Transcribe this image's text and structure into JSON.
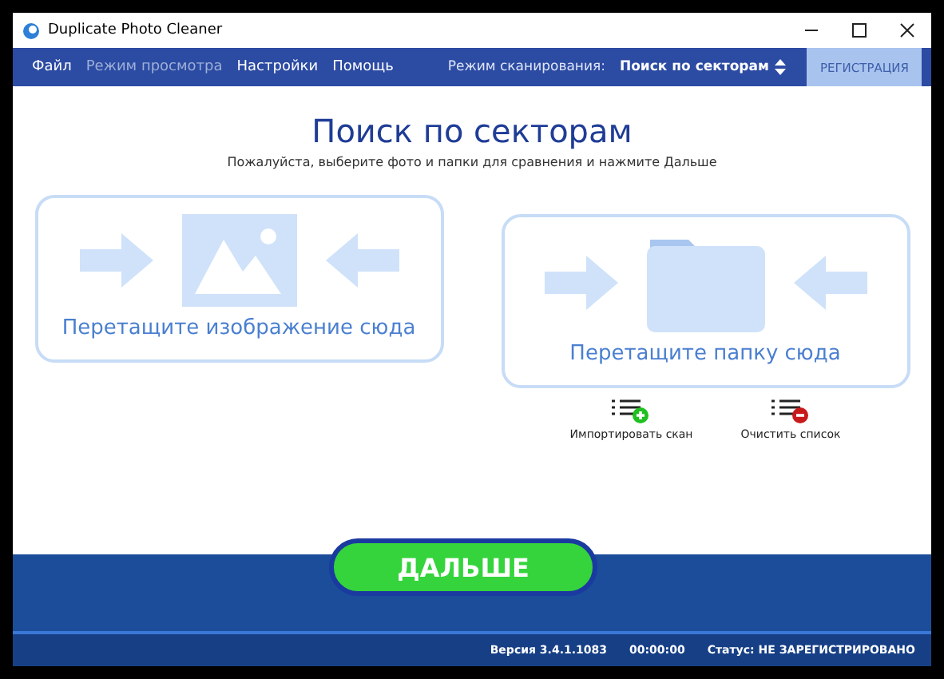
{
  "window": {
    "title": "Duplicate Photo Cleaner"
  },
  "menu": [
    {
      "label": "Файл",
      "disabled": false
    },
    {
      "label": "Режим просмотра",
      "disabled": true
    },
    {
      "label": "Настройки",
      "disabled": false
    },
    {
      "label": "Помощь",
      "disabled": false
    }
  ],
  "scan_mode": {
    "label": "Режим сканирования:",
    "value": "Поиск по секторам"
  },
  "register_button": "РЕГИСТРАЦИЯ",
  "heading": "Поиск по секторам",
  "subtitle": "Пожалуйста, выберите фото и папки для сравнения и нажмите Дальше",
  "drop_zones": [
    {
      "kind": "image",
      "label": "Перетащите изображение сюда"
    },
    {
      "kind": "folder",
      "label": "Перетащите папку сюда"
    }
  ],
  "actions": [
    {
      "kind": "add",
      "label": "Импортировать скан"
    },
    {
      "kind": "remove",
      "label": "Очистить список"
    }
  ],
  "next_button": "ДАЛЬШЕ",
  "status_bar": {
    "version": "Версия 3.4.1.1083",
    "time": "00:00:00",
    "status": "Статус: НЕ ЗАРЕГИСТРИРОВАНО"
  }
}
